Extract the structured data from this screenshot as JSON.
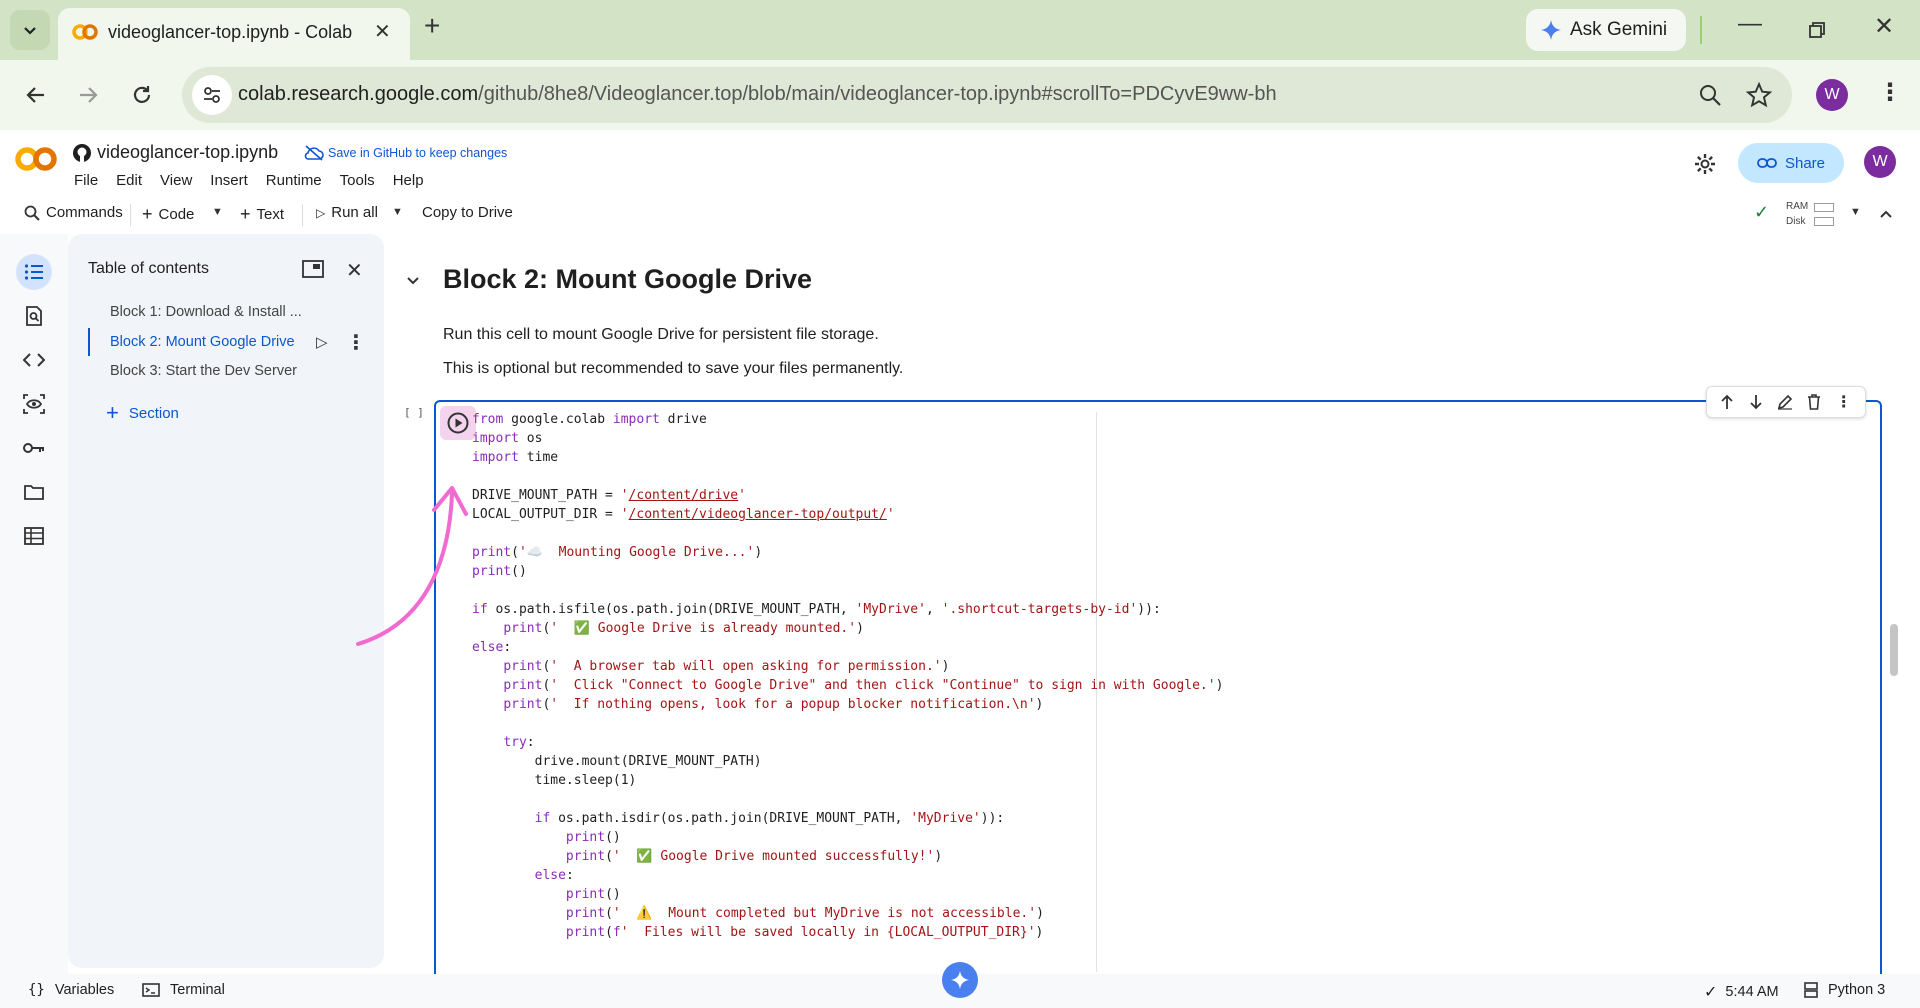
{
  "browser": {
    "tab_title": "videoglancer-top.ipynb - Colab",
    "ask_gemini": "Ask Gemini",
    "url_host": "colab.research.google.com",
    "url_path": "/github/8he8/Videoglancer.top/blob/main/videoglancer-top.ipynb#scrollTo=PDCyvE9ww-bh",
    "profile_initial": "W"
  },
  "colab": {
    "logo": "CO",
    "filename": "videoglancer-top.ipynb",
    "save_github": "Save in GitHub to keep changes",
    "menu": [
      "File",
      "Edit",
      "View",
      "Insert",
      "Runtime",
      "Tools",
      "Help"
    ],
    "share": "Share",
    "user_initial": "W",
    "toolbar": {
      "commands": "Commands",
      "code": "Code",
      "text": "Text",
      "run_all": "Run all",
      "copy_to_drive": "Copy to Drive",
      "ram": "RAM",
      "disk": "Disk"
    }
  },
  "toc": {
    "title": "Table of contents",
    "items": [
      {
        "label": "Block 1: Download & Install ...",
        "active": false
      },
      {
        "label": "Block 2: Mount Google Drive",
        "active": true
      },
      {
        "label": "Block 3: Start the Dev Server",
        "active": false
      }
    ],
    "add_section": "Section"
  },
  "cell": {
    "heading": "Block 2: Mount Google Drive",
    "para1": "Run this cell to mount Google Drive for persistent file storage.",
    "para2": "This is optional but recommended to save your files permanently.",
    "exec_count": "[ ]"
  },
  "status": {
    "variables": "Variables",
    "terminal": "Terminal",
    "time": "5:44 AM",
    "kernel": "Python 3"
  },
  "colors": {
    "accent_blue": "#0b57d0",
    "annotation_pink": "#f06ad0",
    "chrome_green": "#d3e3c5"
  }
}
